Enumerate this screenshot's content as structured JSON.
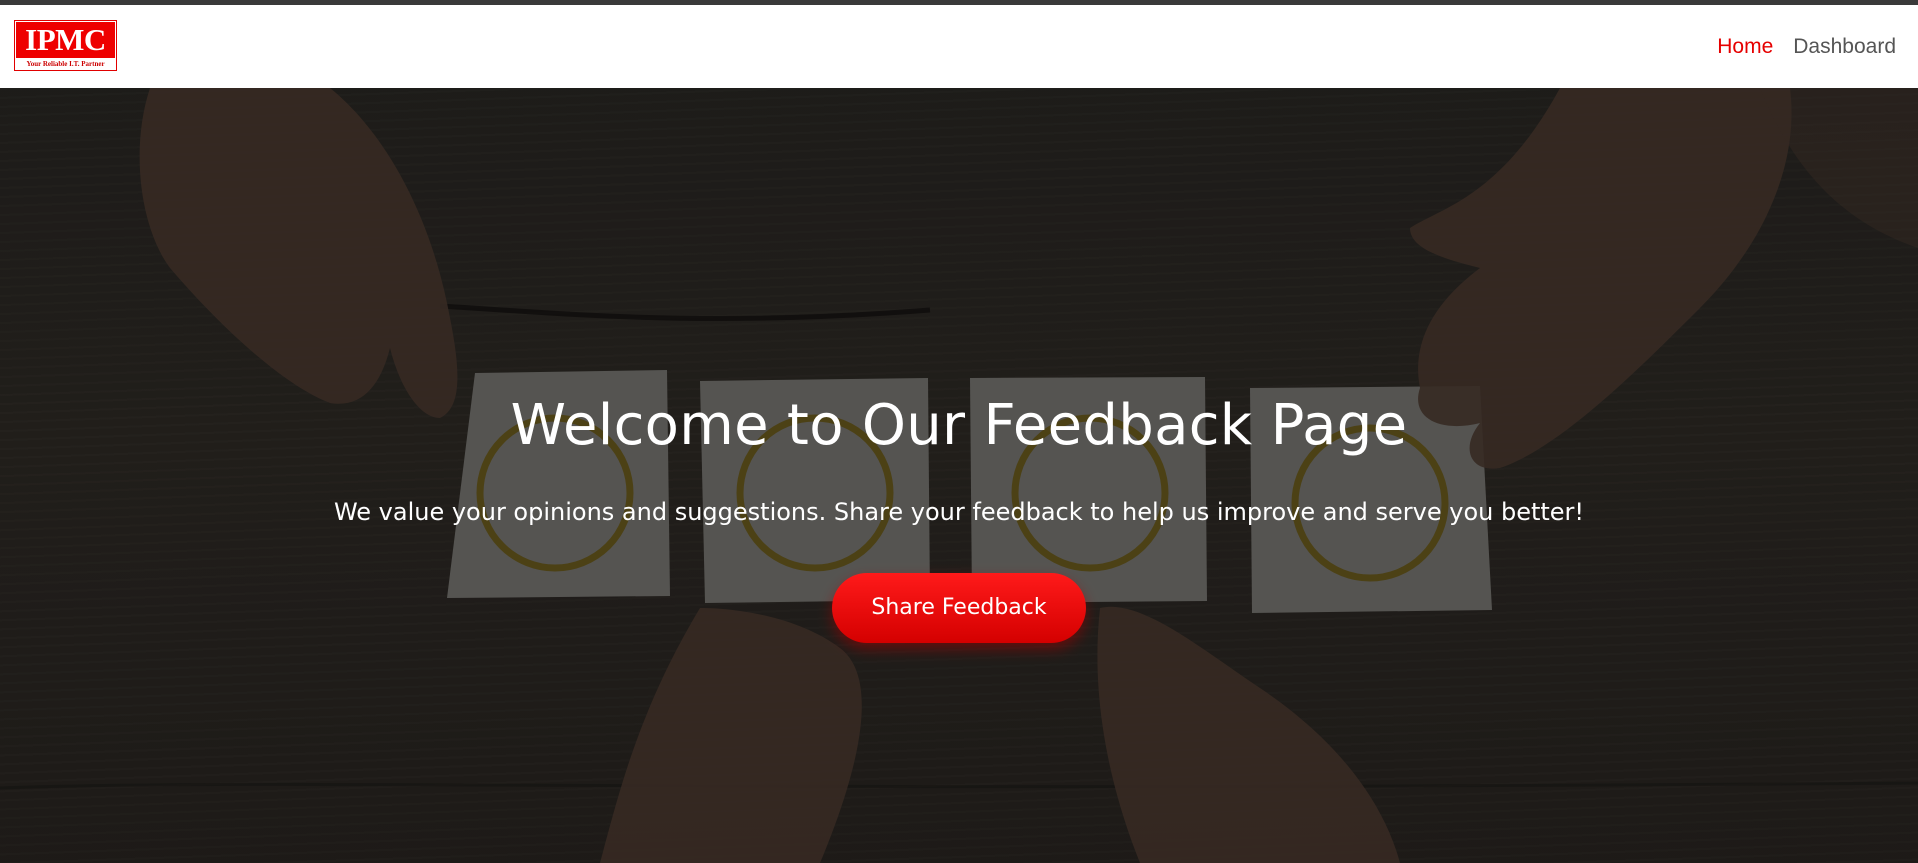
{
  "logo": {
    "text": "IPMC",
    "tagline": "Your Reliable I.T. Partner"
  },
  "nav": {
    "links": [
      {
        "label": "Home",
        "active": true
      },
      {
        "label": "Dashboard",
        "active": false
      }
    ]
  },
  "hero": {
    "title": "Welcome to Our Feedback Page",
    "subtitle": "We value your opinions and suggestions. Share your feedback to help us improve and serve you better!",
    "button_label": "Share Feedback",
    "background_image": "hands-placing-smiley-face-cards-on-wooden-table"
  },
  "colors": {
    "accent": "#e60000",
    "nav_text": "#555555",
    "hero_text": "#ffffff"
  }
}
